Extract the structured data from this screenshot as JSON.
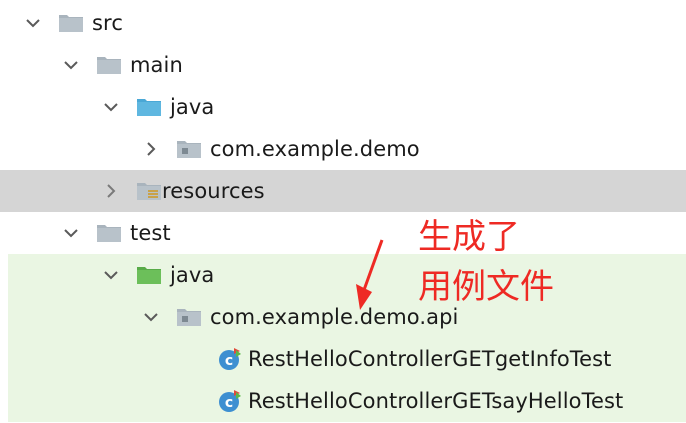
{
  "tree": {
    "nodes": [
      {
        "label": "src",
        "expanded": true,
        "icon": "folder-icon"
      },
      {
        "label": "main",
        "expanded": true,
        "icon": "folder-icon"
      },
      {
        "label": "java",
        "expanded": true,
        "icon": "source-folder-icon"
      },
      {
        "label": "com.example.demo",
        "expanded": false,
        "icon": "package-icon"
      },
      {
        "label": "resources",
        "expanded": false,
        "icon": "resources-folder-icon"
      },
      {
        "label": "test",
        "expanded": true,
        "icon": "folder-icon"
      },
      {
        "label": "java",
        "expanded": true,
        "icon": "test-source-folder-icon"
      },
      {
        "label": "com.example.demo.api",
        "expanded": true,
        "icon": "package-icon"
      },
      {
        "label": "RestHelloControllerGETgetInfoTest",
        "icon": "test-class-icon"
      },
      {
        "label": "RestHelloControllerGETsayHelloTest",
        "icon": "test-class-icon"
      }
    ]
  },
  "annotation": {
    "line1": "生成了",
    "line2": "用例文件",
    "color": "#ee2a24"
  },
  "colors": {
    "selected_row": "#d5d5d5",
    "test_background": "#eaf6e3",
    "folder_gray": "#a9b4bd",
    "source_blue": "#5fb7e0",
    "test_green": "#6cbf5a"
  }
}
